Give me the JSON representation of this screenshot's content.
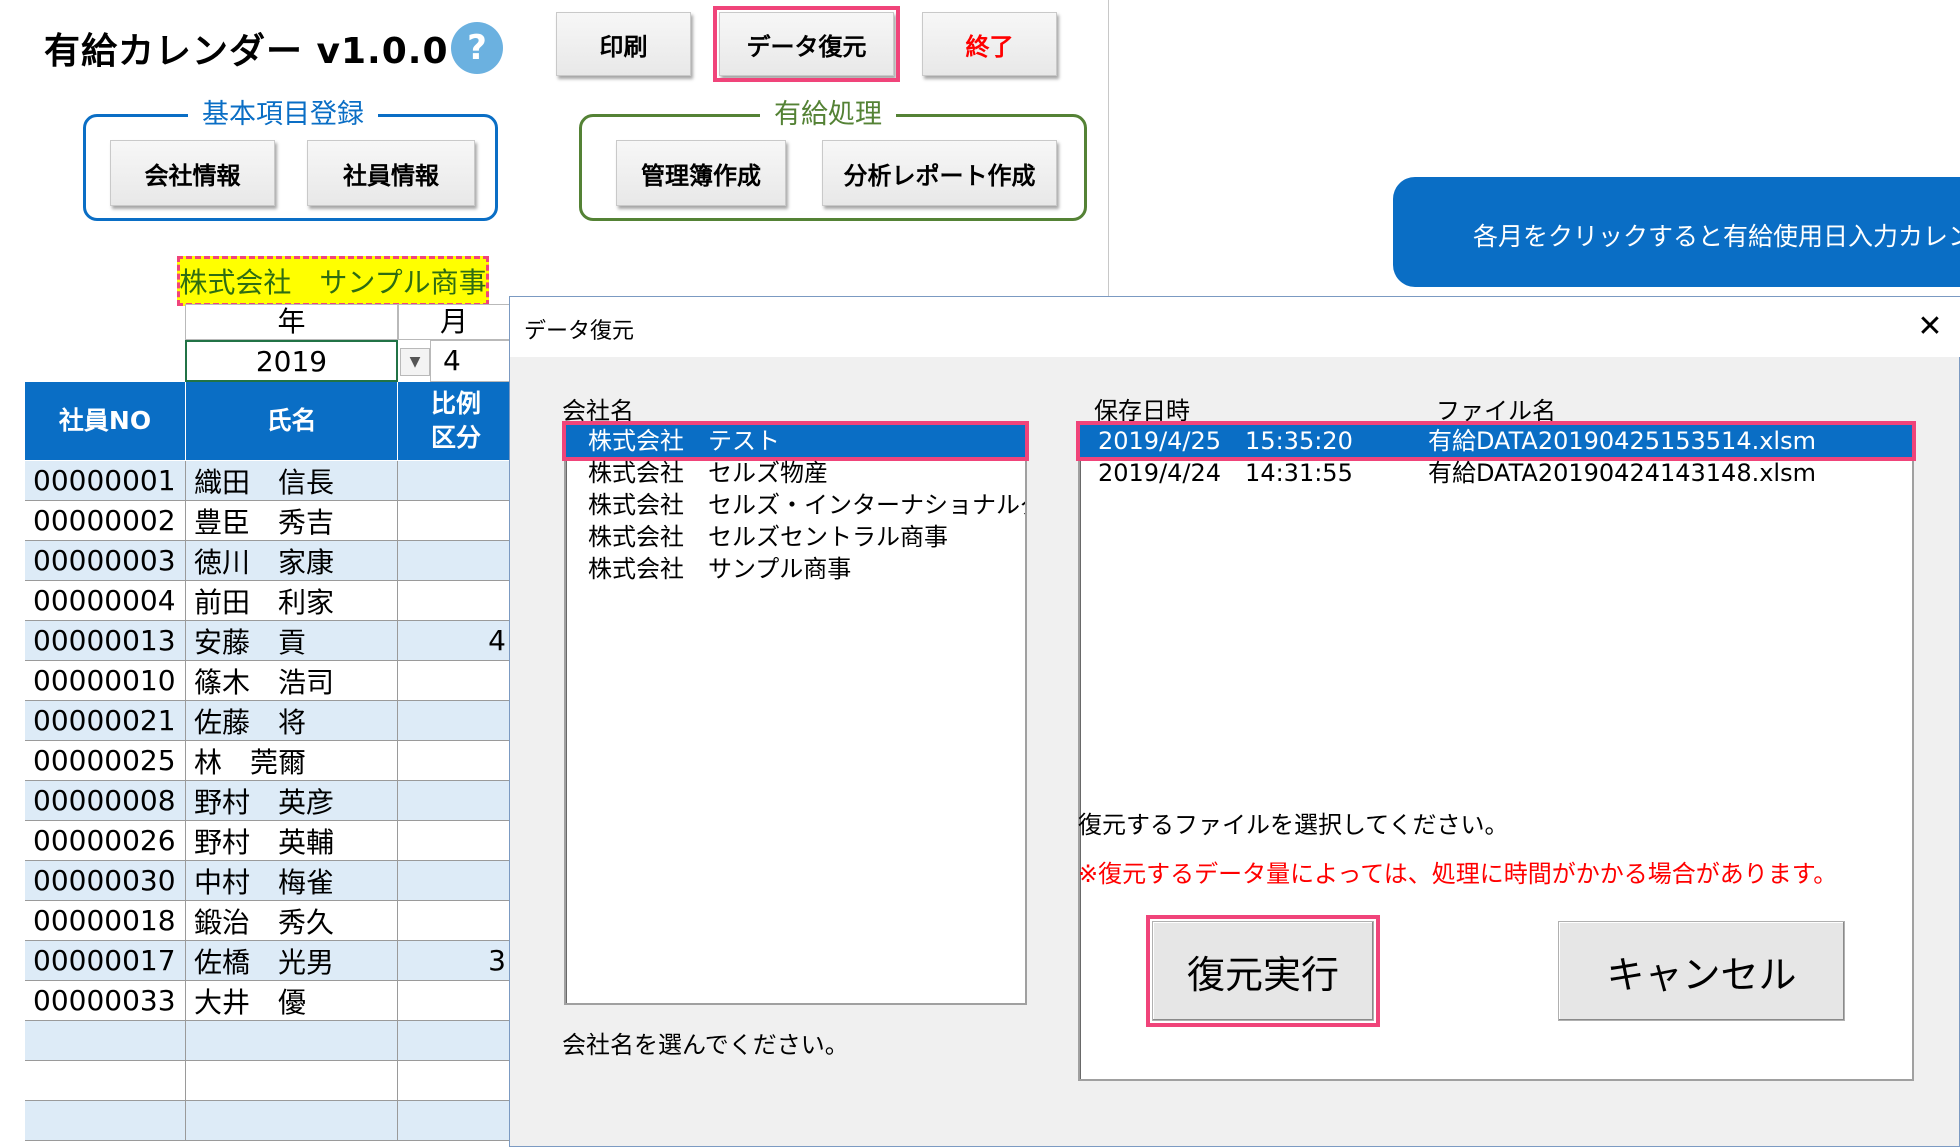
{
  "app": {
    "title": "有給カレンダー v1.0.0",
    "help_symbol": "?"
  },
  "toolbar": {
    "print": "印刷",
    "restore": "データ復元",
    "exit": "終了"
  },
  "groups": {
    "basic": {
      "title": "基本項目登録",
      "company_info": "会社情報",
      "employee_info": "社員情報"
    },
    "paid": {
      "title": "有給処理",
      "ledger": "管理簿作成",
      "report": "分析レポート作成"
    }
  },
  "banner": "各月をクリックすると有給使用日入力カレンダーを表示",
  "company_name": "株式会社　サンプル商事",
  "year_month": {
    "year_label": "年",
    "month_label": "月",
    "year": "2019",
    "month": "4"
  },
  "table": {
    "headers": {
      "no": "社員NO",
      "name": "氏名",
      "ratio_line1": "比例",
      "ratio_line2": "区分"
    },
    "rows": [
      {
        "no": "00000001",
        "name": "織田　信長",
        "ratio": ""
      },
      {
        "no": "00000002",
        "name": "豊臣　秀吉",
        "ratio": ""
      },
      {
        "no": "00000003",
        "name": "徳川　家康",
        "ratio": ""
      },
      {
        "no": "00000004",
        "name": "前田　利家",
        "ratio": ""
      },
      {
        "no": "00000013",
        "name": "安藤　貢",
        "ratio": "4"
      },
      {
        "no": "00000010",
        "name": "篠木　浩司",
        "ratio": ""
      },
      {
        "no": "00000021",
        "name": "佐藤　将",
        "ratio": ""
      },
      {
        "no": "00000025",
        "name": "林　莞爾",
        "ratio": ""
      },
      {
        "no": "00000008",
        "name": "野村　英彦",
        "ratio": ""
      },
      {
        "no": "00000026",
        "name": "野村　英輔",
        "ratio": ""
      },
      {
        "no": "00000030",
        "name": "中村　梅雀",
        "ratio": ""
      },
      {
        "no": "00000018",
        "name": "鍛治　秀久",
        "ratio": ""
      },
      {
        "no": "00000017",
        "name": "佐橋　光男",
        "ratio": "3"
      },
      {
        "no": "00000033",
        "name": "大井　優",
        "ratio": ""
      },
      {
        "no": "",
        "name": "",
        "ratio": ""
      },
      {
        "no": "",
        "name": "",
        "ratio": ""
      },
      {
        "no": "",
        "name": "",
        "ratio": ""
      }
    ]
  },
  "dialog": {
    "title": "データ復元",
    "close": "✕",
    "company_label": "会社名",
    "companies": [
      "株式会社　テスト",
      "株式会社　セルズ物産",
      "株式会社　セルズ・インターナショナルグローバル",
      "株式会社　セルズセントラル商事",
      "株式会社　サンプル商事"
    ],
    "company_hint": "会社名を選んでください。",
    "saved_label": "保存日時",
    "file_label": "ファイル名",
    "files": [
      {
        "datetime": "2019/4/25　15:35:20",
        "file": "有給DATA20190425153514.xlsm"
      },
      {
        "datetime": "2019/4/24　14:31:55",
        "file": "有給DATA20190424143148.xlsm"
      }
    ],
    "file_hint": "復元するファイルを選択してください。",
    "warning": "※復元するデータ量によっては、処理に時間がかかる場合があります。",
    "execute": "復元実行",
    "cancel": "キャンセル"
  },
  "colors": {
    "accent": "#0a6ec5",
    "highlight": "#f0447a",
    "alt_row": "#ddebf7",
    "warning": "#ff0000"
  }
}
